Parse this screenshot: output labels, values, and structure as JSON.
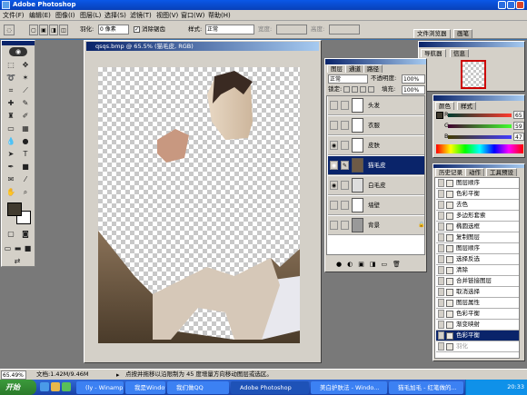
{
  "window": {
    "title": "Adobe Photoshop"
  },
  "menu": [
    "文件(F)",
    "编辑(E)",
    "图像(I)",
    "图层(L)",
    "选择(S)",
    "滤镜(T)",
    "视图(V)",
    "窗口(W)",
    "帮助(H)"
  ],
  "options": {
    "feather_label": "羽化:",
    "feather_value": "0 像素",
    "antialias_label": "消除锯齿",
    "style_label": "样式:",
    "style_value": "正常",
    "width_label": "宽度:",
    "height_label": "高度:",
    "file_browser_tab": "文件浏览器",
    "brush_tab": "画笔"
  },
  "document": {
    "title": "qsqs.bmp @ 65.5% (猫毛皮, RGB)"
  },
  "navigator": {
    "tabs": [
      "导航器",
      "信息"
    ]
  },
  "color_panel": {
    "tabs": [
      "颜色",
      "样式"
    ],
    "r_label": "R",
    "g_label": "G",
    "b_label": "B",
    "r_value": "65",
    "g_value": "59",
    "b_value": "47",
    "swatch": "#413b2f"
  },
  "layers_panel": {
    "tabs": [
      "图层",
      "通道",
      "路径"
    ],
    "blend_mode": "正常",
    "opacity_label": "不透明度:",
    "opacity_value": "100%",
    "lock_label": "锁定:",
    "fill_label": "填充:",
    "fill_value": "100%",
    "layers": [
      {
        "name": "头发",
        "visible": false
      },
      {
        "name": "衣服",
        "visible": false
      },
      {
        "name": "皮肤",
        "visible": true
      },
      {
        "name": "猫毛皮",
        "visible": true
      },
      {
        "name": "白毛皮",
        "visible": true
      },
      {
        "name": "墙壁",
        "visible": false
      },
      {
        "name": "背景",
        "visible": false
      }
    ],
    "selected_index": 3
  },
  "history_panel": {
    "tabs": [
      "历史记录",
      "动作",
      "工具预设"
    ],
    "items": [
      "图层顺序",
      "色彩平衡",
      "去色",
      "多边形套索",
      "椭圆选框",
      "复制图层",
      "图层顺序",
      "选择反选",
      "清除",
      "合并链接图层",
      "取消选择",
      "图层属性",
      "色彩平衡",
      "渐变映射",
      "色彩平衡",
      "羽化"
    ],
    "selected_index": 14
  },
  "status": {
    "zoom": "65.49%",
    "doc_size": "文档:1.42M/9.46M",
    "hint": "点按并拖移以沿限制为 45 度增量方向移动图层或选区。"
  },
  "taskbar": {
    "start": "开始",
    "tasks": [
      "(ly - Winamp *** 2. p...",
      "我是Windows...",
      "我们做QQ",
      "Adobe Photoshop",
      "美白护肤法 - Windo...",
      "猫毛加毛 - 红笔做的..."
    ],
    "active_task_index": 3,
    "clock": "20:33"
  }
}
